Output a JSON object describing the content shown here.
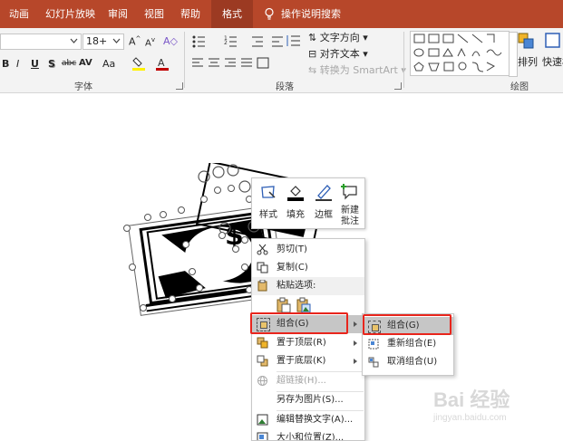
{
  "tabs": [
    "动画",
    "幻灯片放映",
    "审阅",
    "视图",
    "帮助",
    "格式"
  ],
  "active_tab": "格式",
  "tell_me": "操作说明搜索",
  "font_group": {
    "label": "字体",
    "font_size": "18+",
    "format_buttons": [
      "B",
      "I",
      "U",
      "S",
      "abc",
      "AV",
      "Aa"
    ]
  },
  "paragraph_group": {
    "label": "段落",
    "text_direction": "文字方向",
    "align_text": "对齐文本",
    "convert_smartart": "转换为 SmartArt"
  },
  "drawing_group": {
    "label": "绘图",
    "arrange": "排列",
    "quick_styles": "快速样"
  },
  "mini_toolbar": [
    {
      "label": "样式",
      "icon": "style-icon"
    },
    {
      "label": "填充",
      "icon": "fill-icon"
    },
    {
      "label": "边框",
      "icon": "outline-icon"
    },
    {
      "label": "新建\n批注",
      "icon": "new-comment-icon"
    }
  ],
  "mini_new_comment_1": "新建",
  "mini_new_comment_2": "批注",
  "context_menu": {
    "cut": "剪切(T)",
    "copy": "复制(C)",
    "paste_options": "粘贴选项:",
    "group": "组合(G)",
    "bring_front": "置于顶层(R)",
    "send_back": "置于底层(K)",
    "hyperlink": "超链接(H)...",
    "save_picture": "另存为图片(S)...",
    "alt_text": "编辑替换文字(A)...",
    "size_position": "大小和位置(Z)..."
  },
  "submenu": {
    "group": "组合(G)",
    "regroup": "重新组合(E)",
    "ungroup": "取消组合(U)"
  },
  "watermark": {
    "main": "Bai 经验",
    "sub": "jingyan.baidu.com"
  },
  "colors": {
    "accent": "#b7472a",
    "highlight_box": "#e8251c"
  }
}
